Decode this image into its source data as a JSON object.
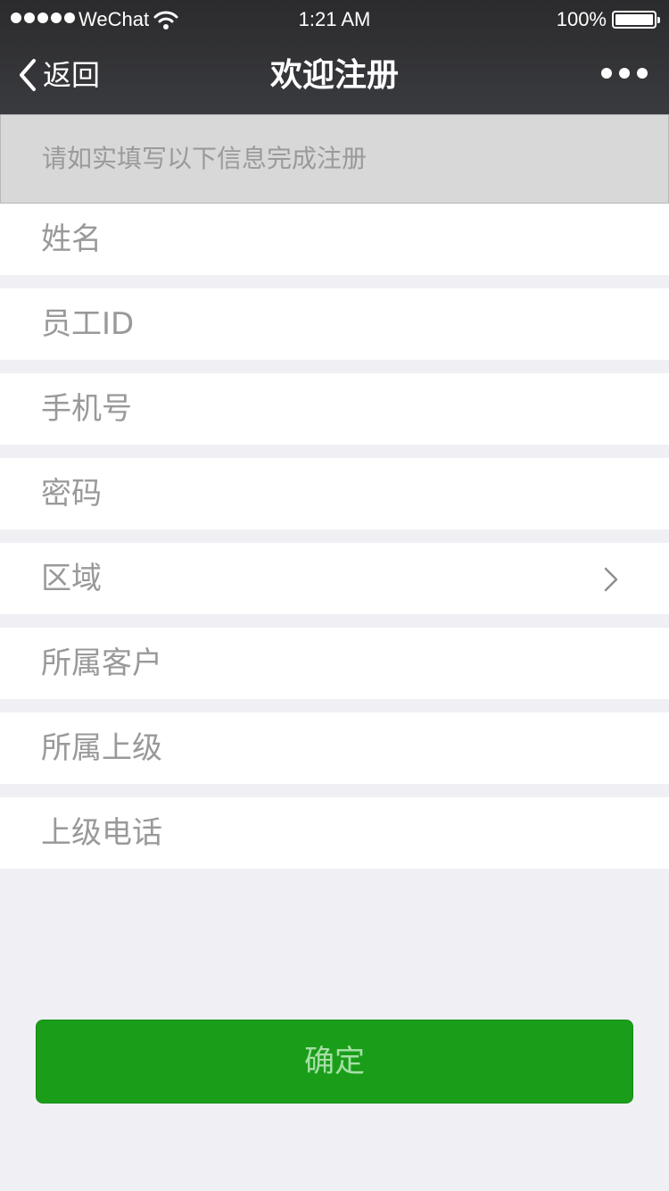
{
  "status_bar": {
    "carrier": "WeChat",
    "time": "1:21 AM",
    "battery": "100%",
    "battery_level": 1.0
  },
  "nav": {
    "back_label": "返回",
    "title": "欢迎注册"
  },
  "notice": "请如实填写以下信息完成注册",
  "form": {
    "fields": [
      {
        "label": "姓名"
      },
      {
        "label": "员工ID"
      },
      {
        "label": "手机号"
      },
      {
        "label": "密码"
      },
      {
        "label": "区域",
        "icon": "chevron-right-icon"
      },
      {
        "label": "所属客户"
      },
      {
        "label": "所属上级"
      },
      {
        "label": "上级电话"
      }
    ]
  },
  "confirm_label": "确定",
  "colors": {
    "nav_bg": "#2b2b2d",
    "page_bg": "#efeff4",
    "notice_bg": "#d8d8d8",
    "label": "#999999",
    "button_green": "#1a9e1a",
    "button_text": "#a7dfa7"
  }
}
